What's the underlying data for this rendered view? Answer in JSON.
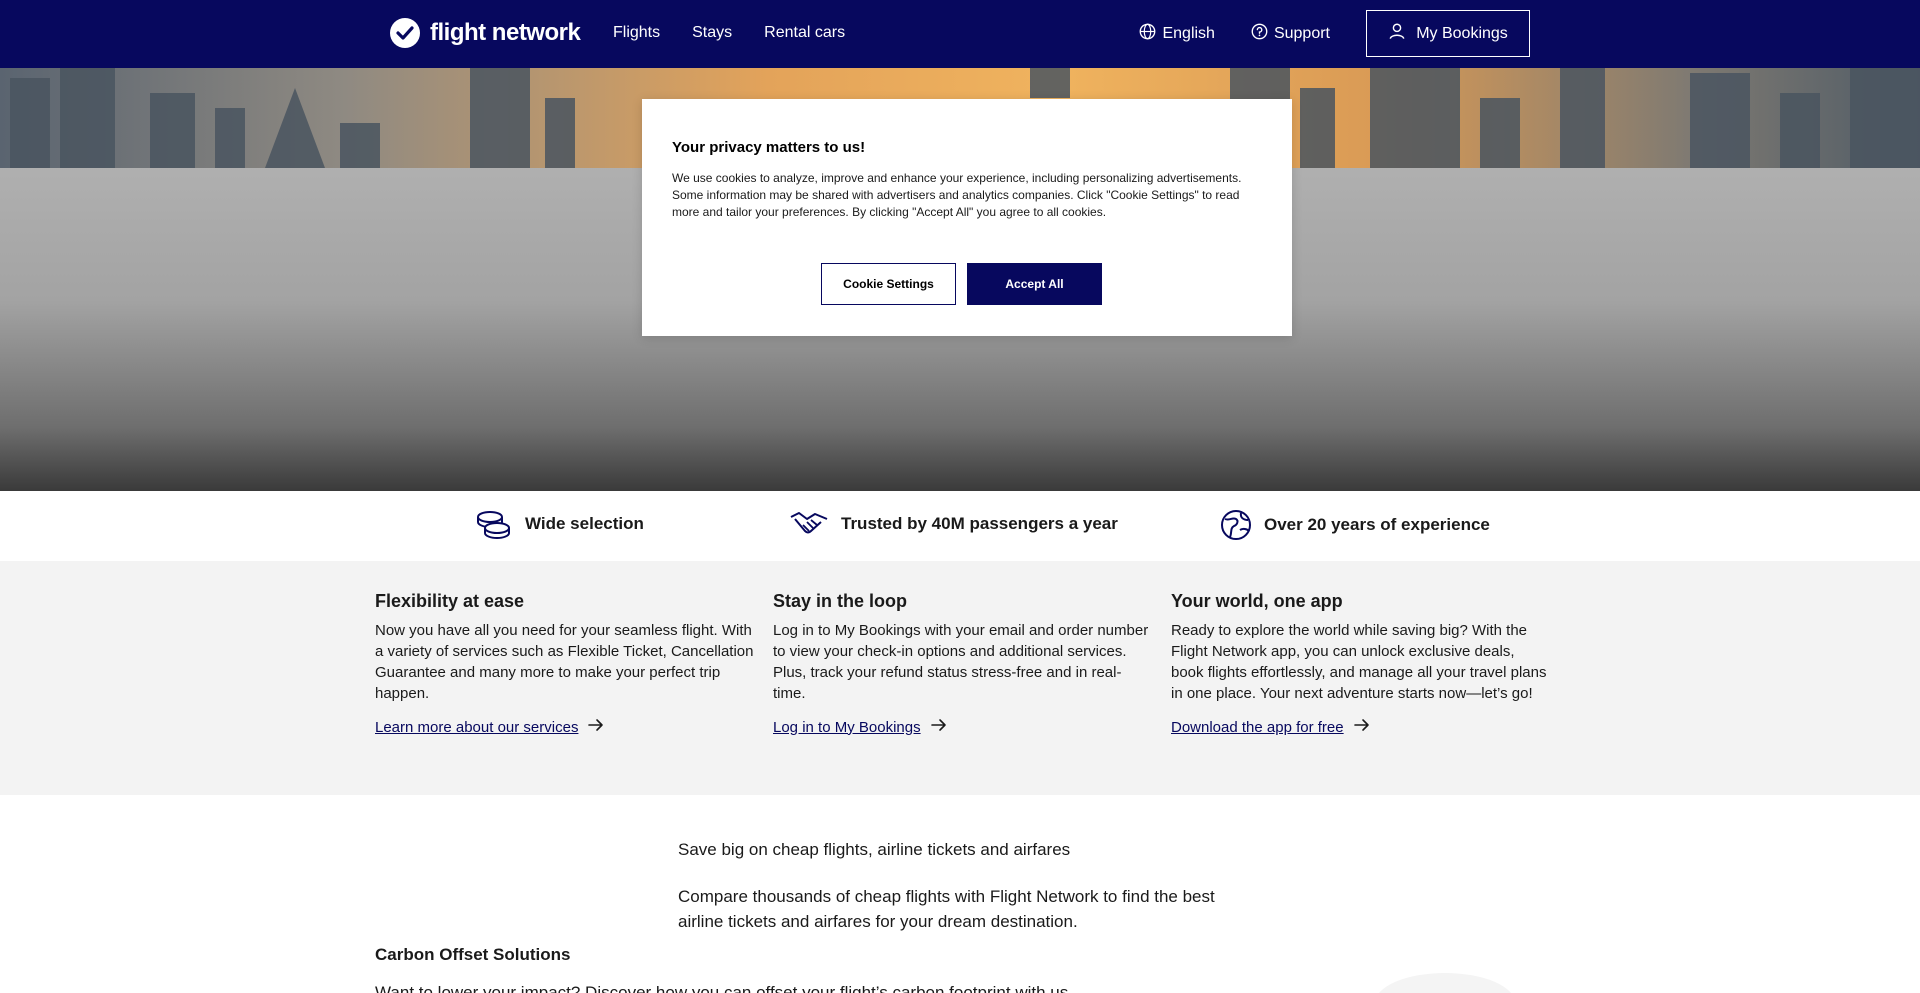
{
  "header": {
    "brand": "flight network",
    "nav": [
      {
        "label": "Flights"
      },
      {
        "label": "Stays"
      },
      {
        "label": "Rental cars"
      }
    ],
    "language": "English",
    "support": "Support",
    "bookings": "My Bookings"
  },
  "cookie": {
    "title": "Your privacy matters to us!",
    "text": "We use cookies to analyze, improve and enhance your experience, including personalizing advertisements. Some information may be shared with advertisers and analytics companies. Click \"Cookie Settings\" to read more and tailor your preferences. By clicking \"Accept All\" you agree to all cookies.",
    "settings_label": "Cookie Settings",
    "accept_label": "Accept All"
  },
  "features": [
    {
      "label": "Wide selection",
      "icon": "coins-icon"
    },
    {
      "label": "Trusted by 40M passengers a year",
      "icon": "handshake-icon"
    },
    {
      "label": "Over 20 years of experience",
      "icon": "globe-icon"
    }
  ],
  "info": [
    {
      "title": "Flexibility at ease",
      "text": "Now you have all you need for your seamless flight. With a variety of services such as Flexible Ticket, Cancellation Guarantee and many more to make your perfect trip happen.",
      "link": "Learn more about our services"
    },
    {
      "title": "Stay in the loop",
      "text": "Log in to My Bookings with your email and order number to view your check-in options and additional services. Plus, track your refund status stress-free and in real-time.",
      "link": "Log in to My Bookings"
    },
    {
      "title": "Your world, one app",
      "text": "Ready to explore the world while saving big? With the Flight Network app, you can unlock exclusive deals, book flights effortlessly, and manage all your travel plans in one place. Your next adventure starts now—let’s go!",
      "link": "Download the app for free"
    }
  ],
  "content": {
    "line1": "Save big on cheap flights, airline tickets and airfares",
    "line2": "Compare thousands of cheap flights with Flight Network to find the best airline tickets and airfares for your dream destination.",
    "heading": "Carbon Offset Solutions",
    "cut_text": "Want to lower your impact? Discover how you can offset your flight’s carbon footprint with us"
  },
  "colors": {
    "brand": "#07085e",
    "panel": "#f3f3f3"
  }
}
